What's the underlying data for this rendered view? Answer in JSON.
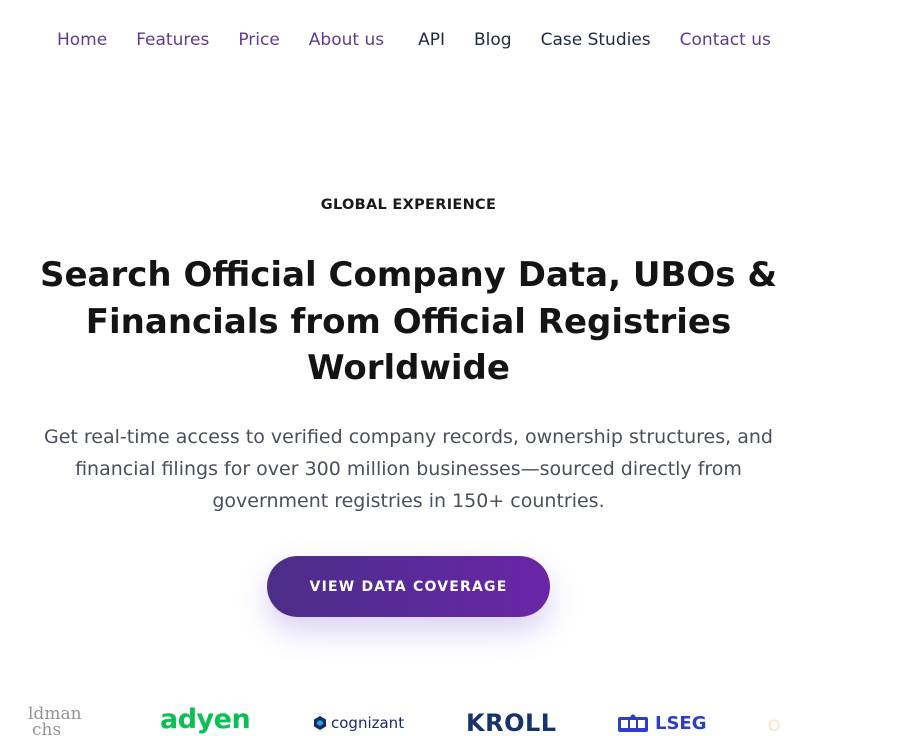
{
  "nav": {
    "items": [
      {
        "label": "Home"
      },
      {
        "label": "Features"
      },
      {
        "label": "Price"
      },
      {
        "label": "About us"
      },
      {
        "label": "API"
      },
      {
        "label": "Blog"
      },
      {
        "label": "Case Studies"
      },
      {
        "label": "Contact us"
      }
    ]
  },
  "hero": {
    "eyebrow": "GLOBAL EXPERIENCE",
    "headline_line1": "Search Official Company Data, UBOs &",
    "headline_line2": "Financials from Official Registries",
    "headline_line3": "Worldwide",
    "subtext": "Get real-time access to verified company records, ownership structures, and financial filings for over 300 million businesses—sourced directly from government registries in 150+ countries.",
    "cta_label": "VIEW DATA COVERAGE"
  },
  "logos": {
    "goldman_line1": "ldman",
    "goldman_line2": "chs",
    "adyen": "adyen",
    "cognizant": "cognizant",
    "kroll": "KROLL",
    "lseg": "LSEG",
    "faded": "O"
  },
  "colors": {
    "nav_purple": "#5b3e91",
    "nav_dark": "#1f2a44",
    "cta_gradient_start": "#4a2e87",
    "cta_gradient_end": "#6a25a6",
    "adyen_green": "#0abf53",
    "lseg_blue": "#2b3ec9",
    "kroll_navy": "#14346b"
  },
  "icons": {
    "cognizant": "cognizant-mark-icon",
    "lseg": "lseg-crest-icon"
  }
}
